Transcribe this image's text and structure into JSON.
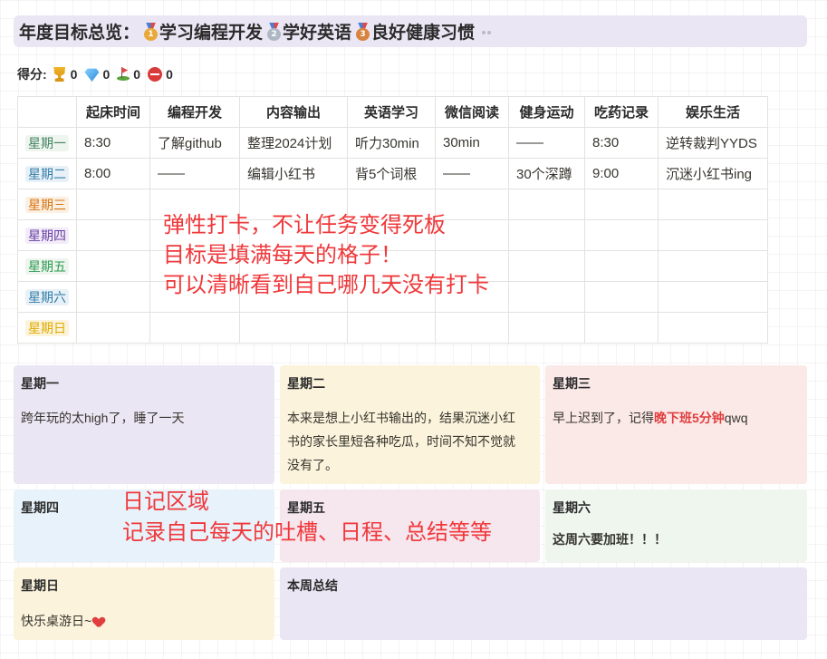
{
  "header": {
    "title": "年度目标总览：",
    "goals": [
      {
        "medal": "1",
        "label": "学习编程开发"
      },
      {
        "medal": "2",
        "label": "学好英语"
      },
      {
        "medal": "3",
        "label": "良好健康习惯"
      }
    ]
  },
  "score": {
    "label": "得分:",
    "items": [
      {
        "icon": "trophy-icon",
        "value": "0"
      },
      {
        "icon": "gem-icon",
        "value": "0"
      },
      {
        "icon": "golf-flag-icon",
        "value": "0"
      },
      {
        "icon": "no-entry-icon",
        "value": "0"
      }
    ]
  },
  "habit_table": {
    "columns": [
      "",
      "起床时间",
      "编程开发",
      "内容输出",
      "英语学习",
      "微信阅读",
      "健身运动",
      "吃药记录",
      "娱乐生活"
    ],
    "rows": [
      {
        "day": "星期一",
        "cells": [
          "8:30",
          "了解github",
          "整理2024计划",
          "听力30min",
          "30min",
          "——",
          "8:30",
          "逆转裁判YYDS"
        ]
      },
      {
        "day": "星期二",
        "cells": [
          "8:00",
          "——",
          "编辑小红书",
          "背5个词根",
          "——",
          "30个深蹲",
          "9:00",
          "沉迷小红书ing"
        ]
      },
      {
        "day": "星期三",
        "cells": [
          "",
          "",
          "",
          "",
          "",
          "",
          "",
          ""
        ]
      },
      {
        "day": "星期四",
        "cells": [
          "",
          "",
          "",
          "",
          "",
          "",
          "",
          ""
        ]
      },
      {
        "day": "星期五",
        "cells": [
          "",
          "",
          "",
          "",
          "",
          "",
          "",
          ""
        ]
      },
      {
        "day": "星期六",
        "cells": [
          "",
          "",
          "",
          "",
          "",
          "",
          "",
          ""
        ]
      },
      {
        "day": "星期日",
        "cells": [
          "",
          "",
          "",
          "",
          "",
          "",
          "",
          ""
        ]
      }
    ]
  },
  "annotation_table": [
    "弹性打卡，不让任务变得死板",
    "目标是填满每天的格子！",
    "可以清晰看到自己哪几天没有打卡"
  ],
  "annotation_diary": [
    "日记区域",
    "记录自己每天的吐槽、日程、总结等等"
  ],
  "diary": {
    "mon": {
      "title": "星期一",
      "body": "跨年玩的太high了，睡了一天"
    },
    "tue": {
      "title": "星期二",
      "body": "本来是想上小红书输出的，结果沉迷小红书的家长里短各种吃瓜，时间不知不觉就没有了。"
    },
    "wed": {
      "title": "星期三",
      "body_pre": "早上迟到了，记得",
      "body_highlight": "晚下班5分钟",
      "body_post": "qwq"
    },
    "thu": {
      "title": "星期四",
      "body": ""
    },
    "fri": {
      "title": "星期五",
      "body": ""
    },
    "sat": {
      "title": "星期六",
      "body_highlight": "这周六要加班！！！"
    },
    "sun": {
      "title": "星期日",
      "body": "快乐桌游日~",
      "icon": "heart-icon"
    },
    "summary": {
      "title": "本周总结",
      "body": ""
    }
  },
  "colors": {
    "annotation": "#f0383b",
    "highlight": "#e03e3e"
  }
}
